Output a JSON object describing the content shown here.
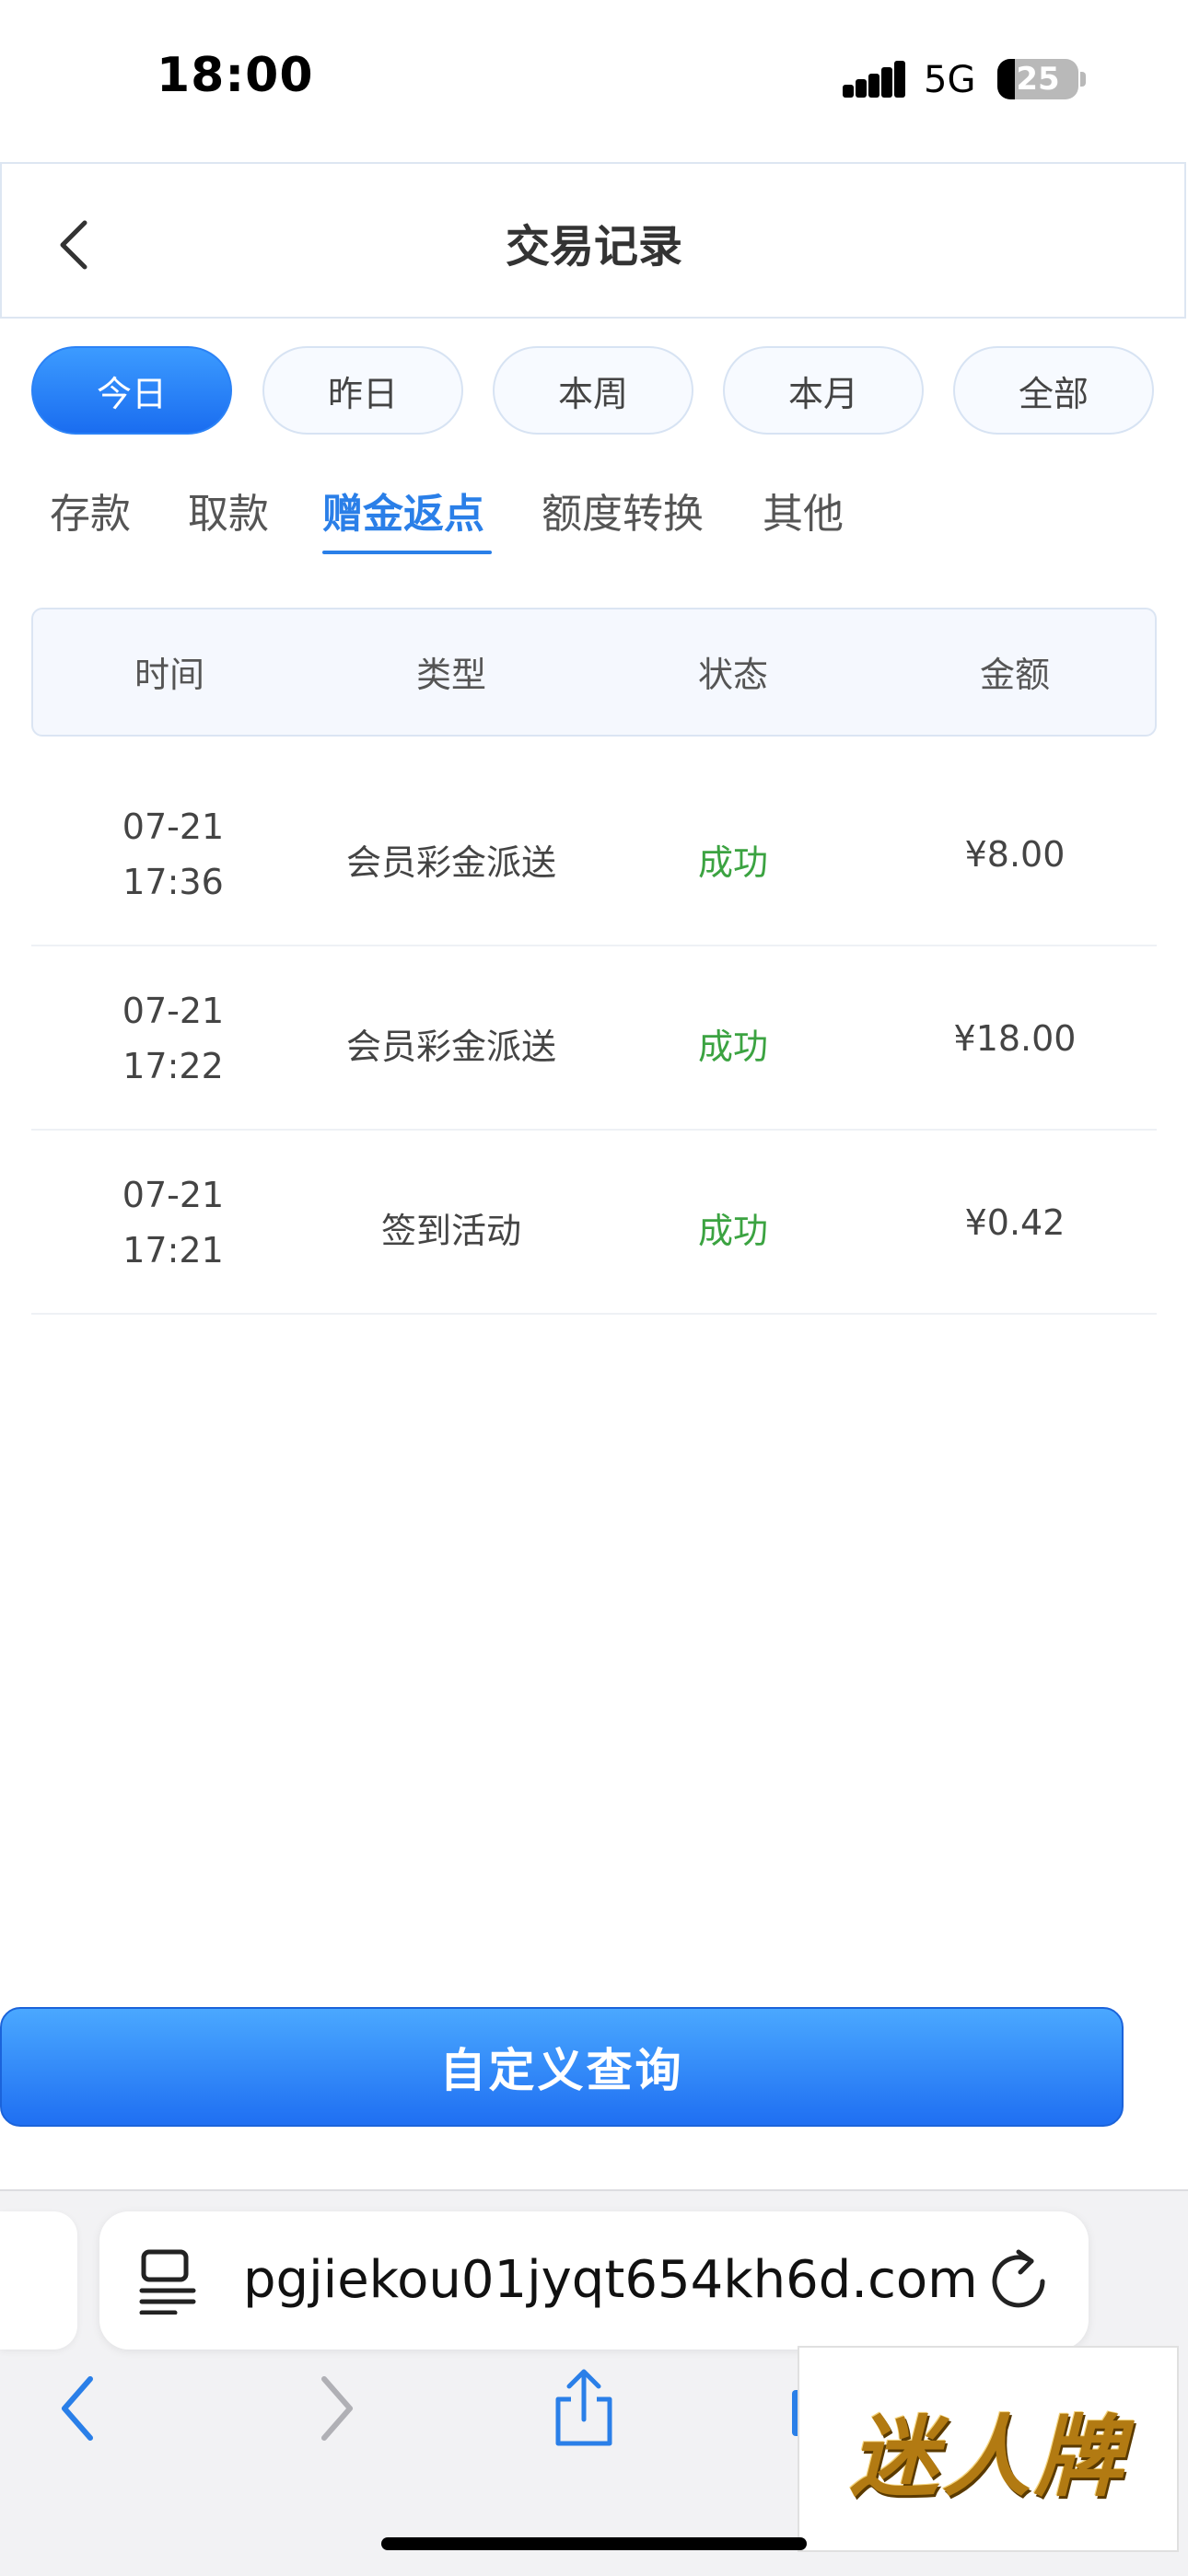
{
  "status_bar": {
    "time": "18:00",
    "network": "5G",
    "battery": "25"
  },
  "header": {
    "title": "交易记录"
  },
  "periods": [
    {
      "label": "今日",
      "active": true
    },
    {
      "label": "昨日",
      "active": false
    },
    {
      "label": "本周",
      "active": false
    },
    {
      "label": "本月",
      "active": false
    },
    {
      "label": "全部",
      "active": false
    }
  ],
  "categories": [
    {
      "label": "存款",
      "active": false
    },
    {
      "label": "取款",
      "active": false
    },
    {
      "label": "赠金返点",
      "active": true
    },
    {
      "label": "额度转换",
      "active": false
    },
    {
      "label": "其他",
      "active": false
    }
  ],
  "table": {
    "columns": [
      "时间",
      "类型",
      "状态",
      "金额"
    ],
    "rows": [
      {
        "date": "07-21",
        "time": "17:36",
        "type": "会员彩金派送",
        "status": "成功",
        "amount": "¥8.00"
      },
      {
        "date": "07-21",
        "time": "17:22",
        "type": "会员彩金派送",
        "status": "成功",
        "amount": "¥18.00"
      },
      {
        "date": "07-21",
        "time": "17:21",
        "type": "签到活动",
        "status": "成功",
        "amount": "¥0.42"
      }
    ]
  },
  "query_button": {
    "label": "自定义查询"
  },
  "browser": {
    "url": "pgjiekou01jyqt654kh6d.com"
  },
  "watermark": {
    "text": "迷人牌"
  },
  "colors": {
    "accent": "#2a7fe8",
    "success": "#3ba341",
    "button": "#1f6ff2"
  }
}
